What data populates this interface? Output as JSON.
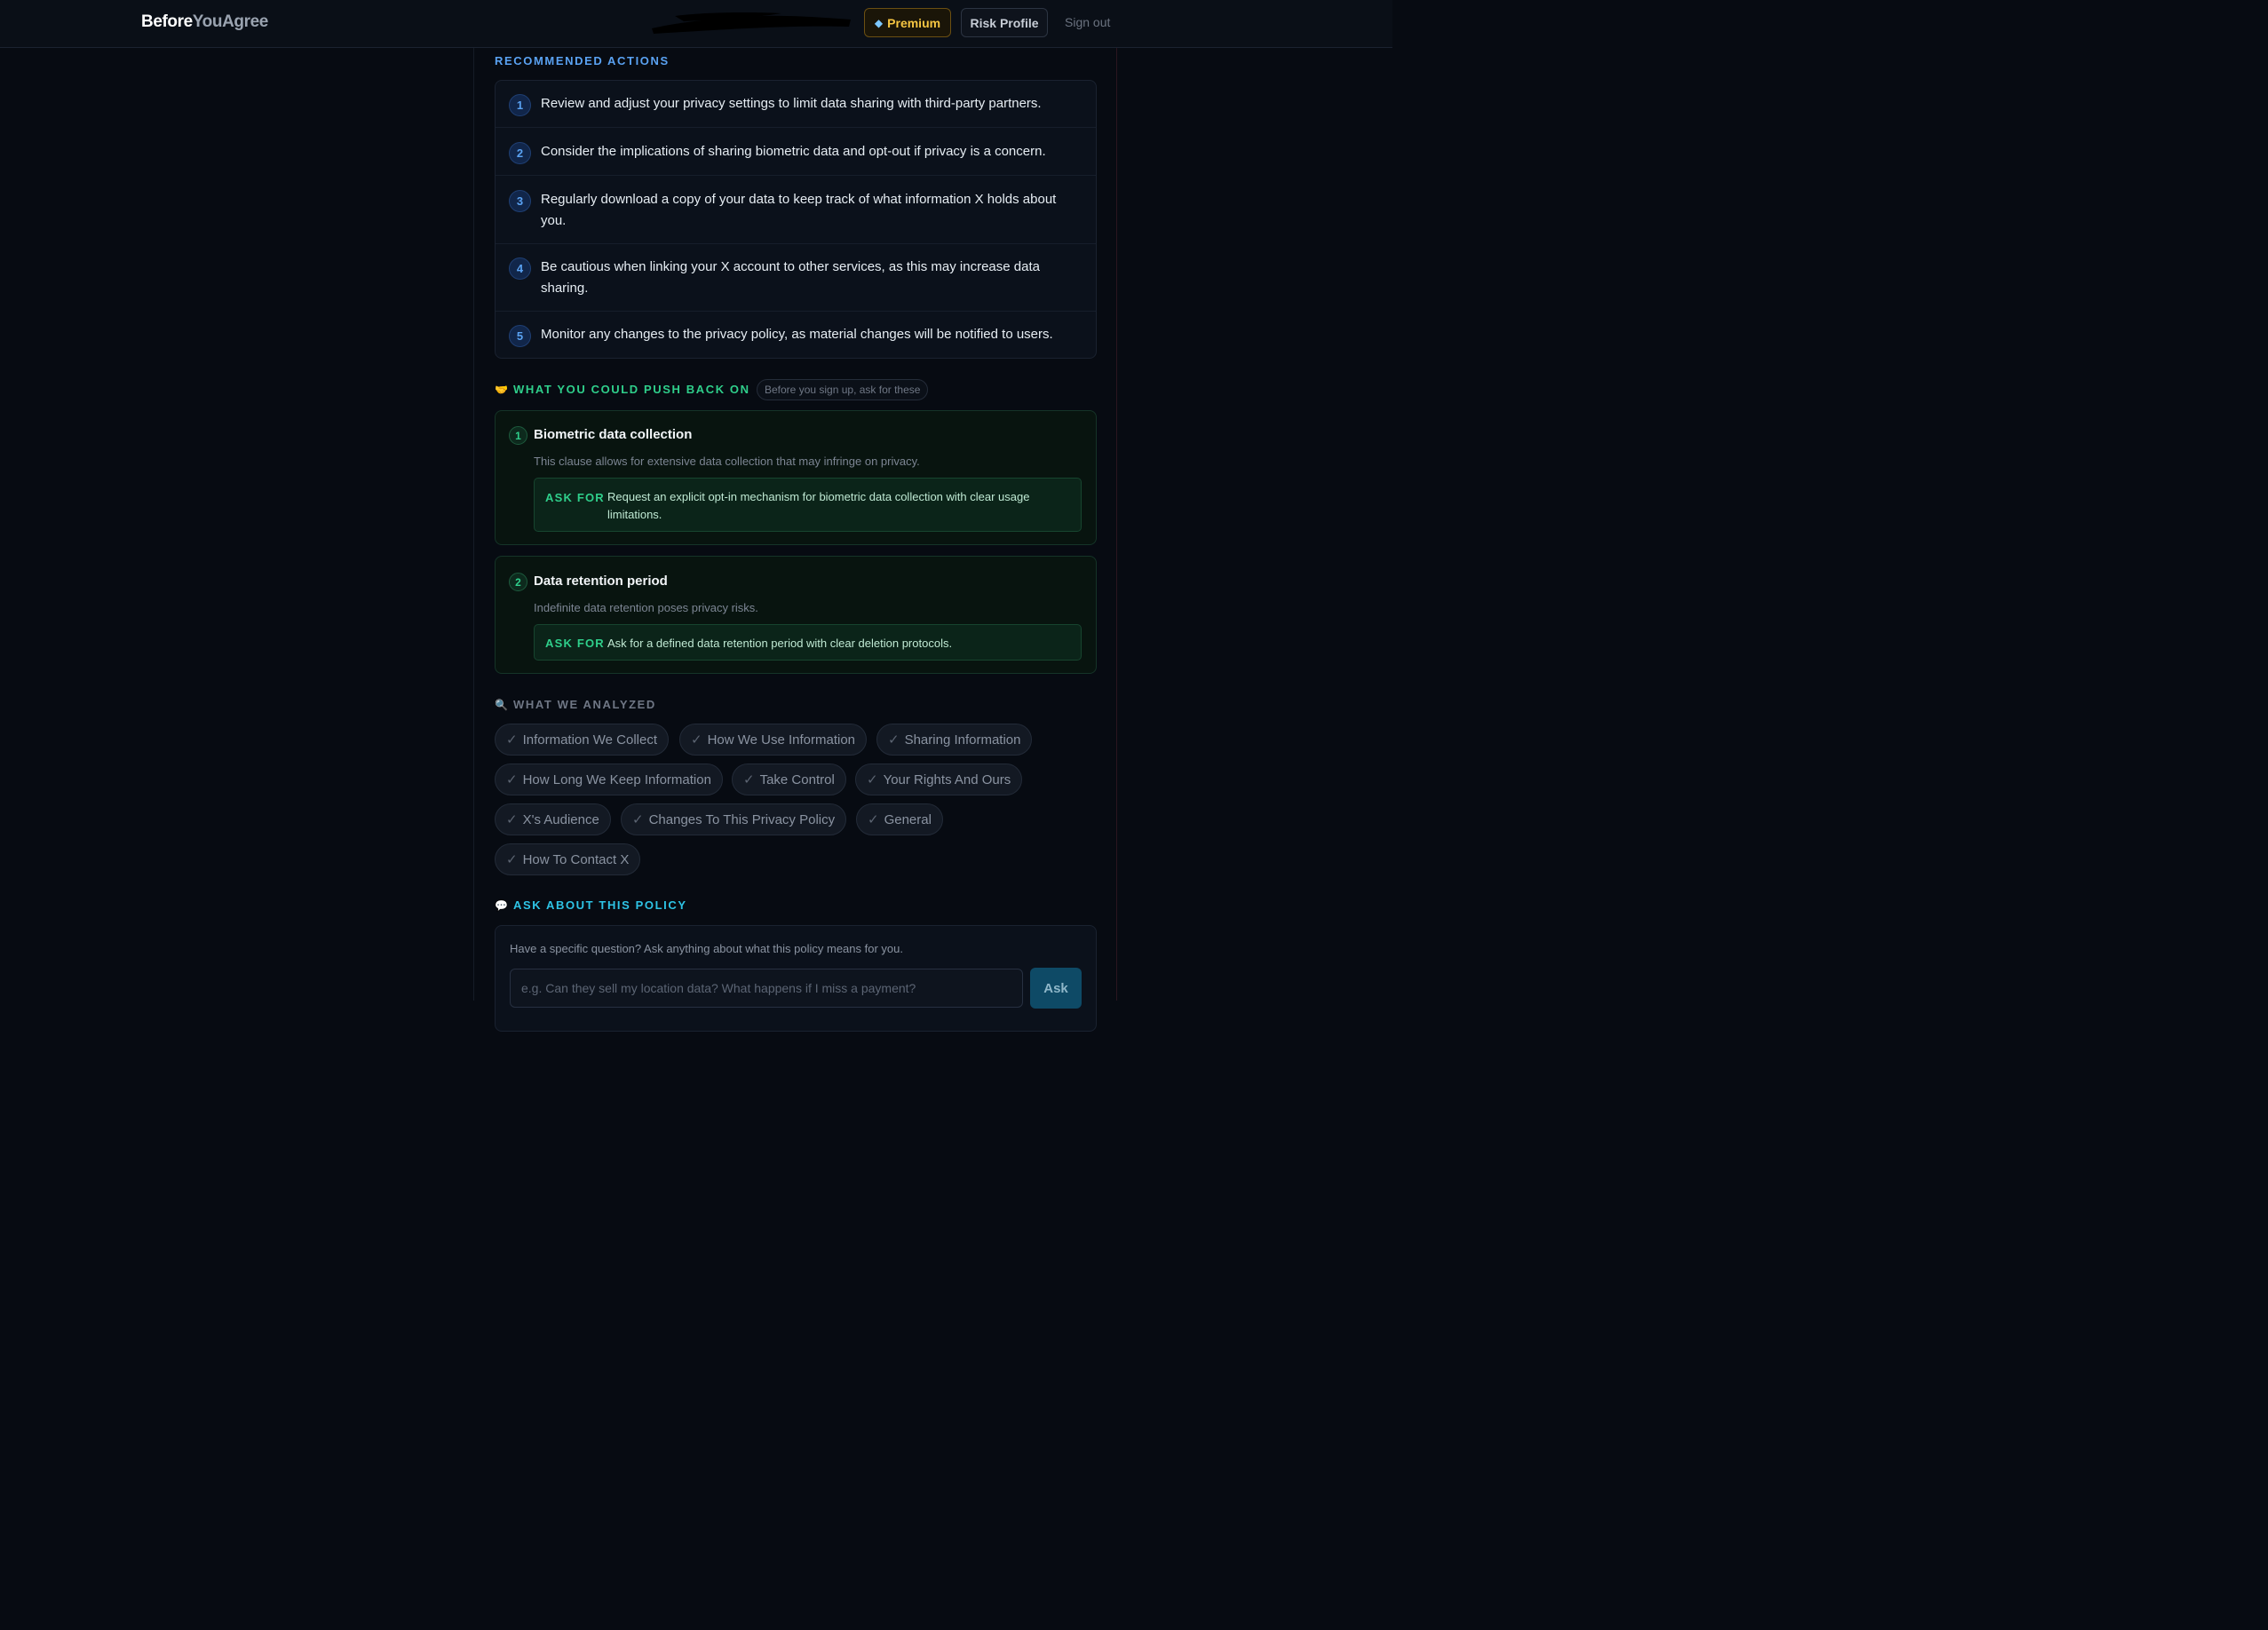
{
  "nav": {
    "brand_part1": "Before",
    "brand_part2": "YouAgree",
    "premium_label": "Premium",
    "premium_icon": "gem-icon",
    "risk_profile_label": "Risk Profile",
    "sign_out_label": "Sign out"
  },
  "recommended": {
    "title": "RECOMMENDED ACTIONS",
    "items": [
      {
        "num": "1",
        "text": "Review and adjust your privacy settings to limit data sharing with third-party partners."
      },
      {
        "num": "2",
        "text": "Consider the implications of sharing biometric data and opt-out if privacy is a concern."
      },
      {
        "num": "3",
        "text": "Regularly download a copy of your data to keep track of what information X holds about you."
      },
      {
        "num": "4",
        "text": "Be cautious when linking your X account to other services, as this may increase data sharing."
      },
      {
        "num": "5",
        "text": "Monitor any changes to the privacy policy, as material changes will be notified to users."
      }
    ]
  },
  "pushback": {
    "icon": "handshake-icon",
    "title": "WHAT YOU COULD PUSH BACK ON",
    "hint": "Before you sign up, ask for these",
    "ask_label": "ASK FOR",
    "items": [
      {
        "num": "1",
        "title": "Biometric data collection",
        "desc": "This clause allows for extensive data collection that may infringe on privacy.",
        "ask": "Request an explicit opt-in mechanism for biometric data collection with clear usage limitations."
      },
      {
        "num": "2",
        "title": "Data retention period",
        "desc": "Indefinite data retention poses privacy risks.",
        "ask": "Ask for a defined data retention period with clear deletion protocols."
      }
    ]
  },
  "analyzed": {
    "icon": "magnifier-icon",
    "title": "WHAT WE ANALYZED",
    "chips": [
      "Information We Collect",
      "How We Use Information",
      "Sharing Information",
      "How Long We Keep Information",
      "Take Control",
      "Your Rights And Ours",
      "X's Audience",
      "Changes To This Privacy Policy",
      "General",
      "How To Contact X"
    ]
  },
  "ask": {
    "icon": "speech-bubble-icon",
    "title": "ASK ABOUT THIS POLICY",
    "intro": "Have a specific question? Ask anything about what this policy means for you.",
    "placeholder": "e.g. Can they sell my location data? What happens if I miss a payment?",
    "value": "",
    "button_label": "Ask"
  },
  "colors": {
    "background": "#070b12",
    "accent_blue": "#5aa2f2",
    "accent_green": "#2fcf8b",
    "premium_gold": "#f5c542",
    "accent_cyan": "#2ec4e6"
  }
}
